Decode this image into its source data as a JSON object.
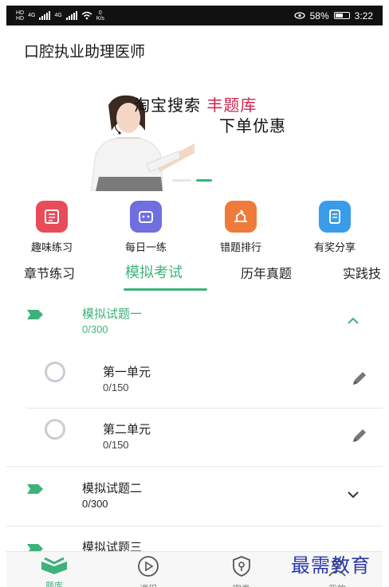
{
  "status_bar": {
    "net_top": "HD",
    "net_bottom": "HD",
    "signal1_label": "4G",
    "signal2_label": "4G",
    "speed_value": "0",
    "speed_unit": "K/s",
    "battery_percent": "58%",
    "battery_level": 0.58,
    "time": "3:22"
  },
  "header": {
    "title": "口腔执业助理医师"
  },
  "banner": {
    "line1_prefix": "淘宝搜索",
    "line1_highlight": "丰题库",
    "line2": "下单优惠",
    "highlight_color": "#d0234a"
  },
  "quick_actions": [
    {
      "label": "趣味练习",
      "icon": "practice-icon",
      "color": "#e84c5a"
    },
    {
      "label": "每日一练",
      "icon": "daily-icon",
      "color": "#6f6fe0"
    },
    {
      "label": "错题排行",
      "icon": "mistakes-icon",
      "color": "#f07a3a"
    },
    {
      "label": "有奖分享",
      "icon": "share-icon",
      "color": "#3a9be8"
    }
  ],
  "tabs": [
    {
      "label": "章节练习",
      "active": false
    },
    {
      "label": "模拟考试",
      "active": true
    },
    {
      "label": "历年真题",
      "active": false
    },
    {
      "label": "实践技",
      "active": false
    }
  ],
  "accent_color": "#3db27a",
  "sections": [
    {
      "title": "模拟试题一",
      "count": "0/300",
      "expanded": true,
      "items": [
        {
          "title": "第一单元",
          "count": "0/150"
        },
        {
          "title": "第二单元",
          "count": "0/150"
        }
      ]
    },
    {
      "title": "模拟试题二",
      "count": "0/300",
      "expanded": false
    },
    {
      "title": "模拟试题三",
      "count": "",
      "expanded": false
    }
  ],
  "bottom_nav": [
    {
      "label": "题库",
      "icon": "book-icon",
      "active": true
    },
    {
      "label": "课程",
      "icon": "play-icon",
      "active": false
    },
    {
      "label": "密卷",
      "icon": "secret-icon",
      "active": false
    },
    {
      "label": "我的",
      "icon": "profile-icon",
      "active": false
    }
  ],
  "watermark": "最需教育"
}
